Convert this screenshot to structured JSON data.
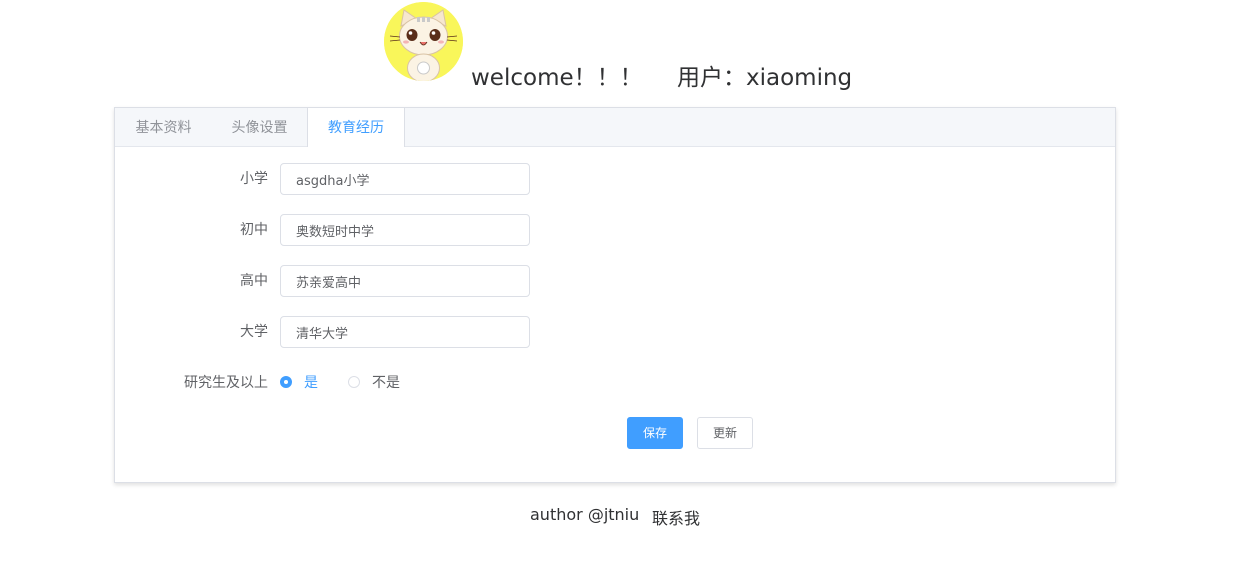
{
  "header": {
    "avatar_alt": "cat-avatar",
    "welcome": "welcome！！！",
    "user_label": "用户：xiaoming"
  },
  "tabs": [
    {
      "label": "基本资料",
      "active": false
    },
    {
      "label": "头像设置",
      "active": false
    },
    {
      "label": "教育经历",
      "active": true
    }
  ],
  "form": {
    "primary_school": {
      "label": "小学",
      "value": "asgdha小学"
    },
    "junior_high": {
      "label": "初中",
      "value": "奥数短时中学"
    },
    "senior_high": {
      "label": "高中",
      "value": "苏亲爱高中"
    },
    "university": {
      "label": "大学",
      "value": "清华大学"
    },
    "postgrad": {
      "label": "研究生及以上",
      "options": [
        {
          "label": "是",
          "checked": true
        },
        {
          "label": "不是",
          "checked": false
        }
      ]
    },
    "save_label": "保存",
    "update_label": "更新"
  },
  "footer": {
    "author": "author @jtniu",
    "contact": "联系我"
  },
  "colors": {
    "accent": "#409eff",
    "avatar_bg": "#f9f65a"
  }
}
